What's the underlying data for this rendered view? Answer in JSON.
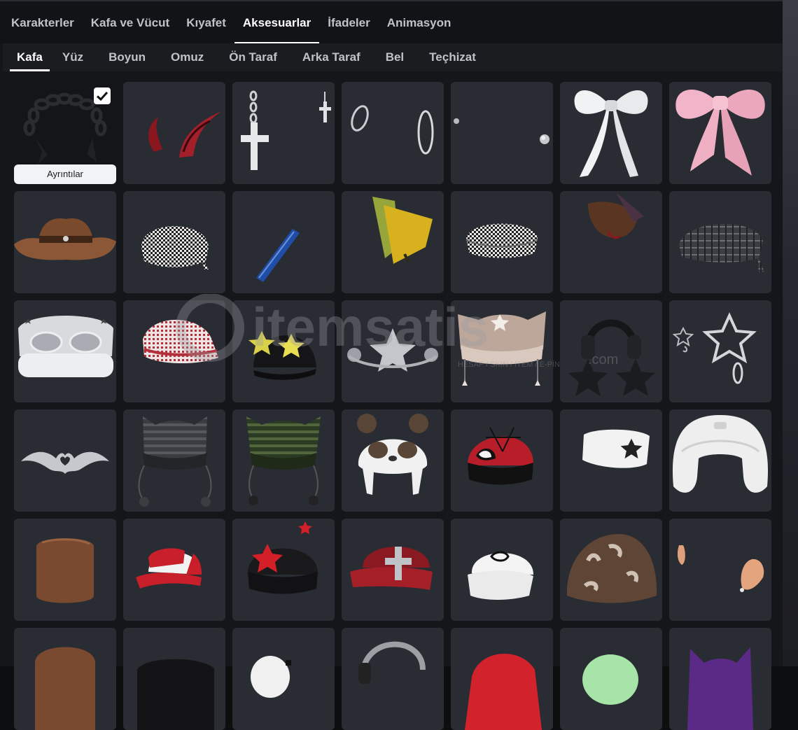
{
  "main_tabs": [
    {
      "label": "Karakterler",
      "active": false
    },
    {
      "label": "Kafa ve Vücut",
      "active": false
    },
    {
      "label": "Kıyafet",
      "active": false
    },
    {
      "label": "Aksesuarlar",
      "active": true
    },
    {
      "label": "İfadeler",
      "active": false
    },
    {
      "label": "Animasyon",
      "active": false
    }
  ],
  "sub_tabs": [
    {
      "label": "Kafa",
      "active": true
    },
    {
      "label": "Yüz",
      "active": false
    },
    {
      "label": "Boyun",
      "active": false
    },
    {
      "label": "Omuz",
      "active": false
    },
    {
      "label": "Ön Taraf",
      "active": false
    },
    {
      "label": "Arka Taraf",
      "active": false
    },
    {
      "label": "Bel",
      "active": false
    },
    {
      "label": "Teçhizat",
      "active": false
    }
  ],
  "selected_item": {
    "checked": true,
    "details_label": "Ayrıntılar"
  },
  "watermark": {
    "brand": "itemsatis",
    "tagline": "HESAP / SKIN / İTEM / E-PİN",
    "domain": ".com"
  },
  "items": [
    {
      "icon": "black-chain-hair-icon"
    },
    {
      "icon": "red-devil-horns-icon"
    },
    {
      "icon": "silver-cross-earrings-icon"
    },
    {
      "icon": "silver-hoop-earrings-icon"
    },
    {
      "icon": "small-stud-earrings-icon"
    },
    {
      "icon": "white-bow-icon"
    },
    {
      "icon": "pink-bow-icon"
    },
    {
      "icon": "brown-cowboy-hat-icon"
    },
    {
      "icon": "houndstooth-bandana-icon"
    },
    {
      "icon": "blue-hair-clip-icon"
    },
    {
      "icon": "yellow-visor-icon"
    },
    {
      "icon": "houndstooth-headband-icon"
    },
    {
      "icon": "brown-feather-hat-icon"
    },
    {
      "icon": "plaid-bandana-icon"
    },
    {
      "icon": "white-star-goggles-beanie-icon"
    },
    {
      "icon": "red-keffiyeh-bandana-icon"
    },
    {
      "icon": "black-star-beanie-icon"
    },
    {
      "icon": "silver-star-tiara-icon"
    },
    {
      "icon": "beige-star-cat-beanie-icon"
    },
    {
      "icon": "black-star-headphones-icon"
    },
    {
      "icon": "star-earrings-icon"
    },
    {
      "icon": "tribal-heart-tiara-icon"
    },
    {
      "icon": "grey-striped-cat-beanie-icon"
    },
    {
      "icon": "green-striped-cat-beanie-icon"
    },
    {
      "icon": "panda-hat-icon"
    },
    {
      "icon": "spider-beanie-icon"
    },
    {
      "icon": "white-star-bucket-icon"
    },
    {
      "icon": "white-knit-hood-icon"
    },
    {
      "icon": "brown-hair-icon"
    },
    {
      "icon": "red-trucker-cap-icon"
    },
    {
      "icon": "black-red-star-beanie-icon"
    },
    {
      "icon": "red-cross-cap-icon"
    },
    {
      "icon": "white-logo-cap-icon"
    },
    {
      "icon": "brown-print-beanie-icon"
    },
    {
      "icon": "ears-icon"
    },
    {
      "icon": "brown-item-icon"
    },
    {
      "icon": "black-item-icon"
    },
    {
      "icon": "white-item-icon"
    },
    {
      "icon": "headphones-item-icon"
    },
    {
      "icon": "santa-hat-icon"
    },
    {
      "icon": "green-item-icon"
    },
    {
      "icon": "purple-cat-hat-icon"
    }
  ]
}
